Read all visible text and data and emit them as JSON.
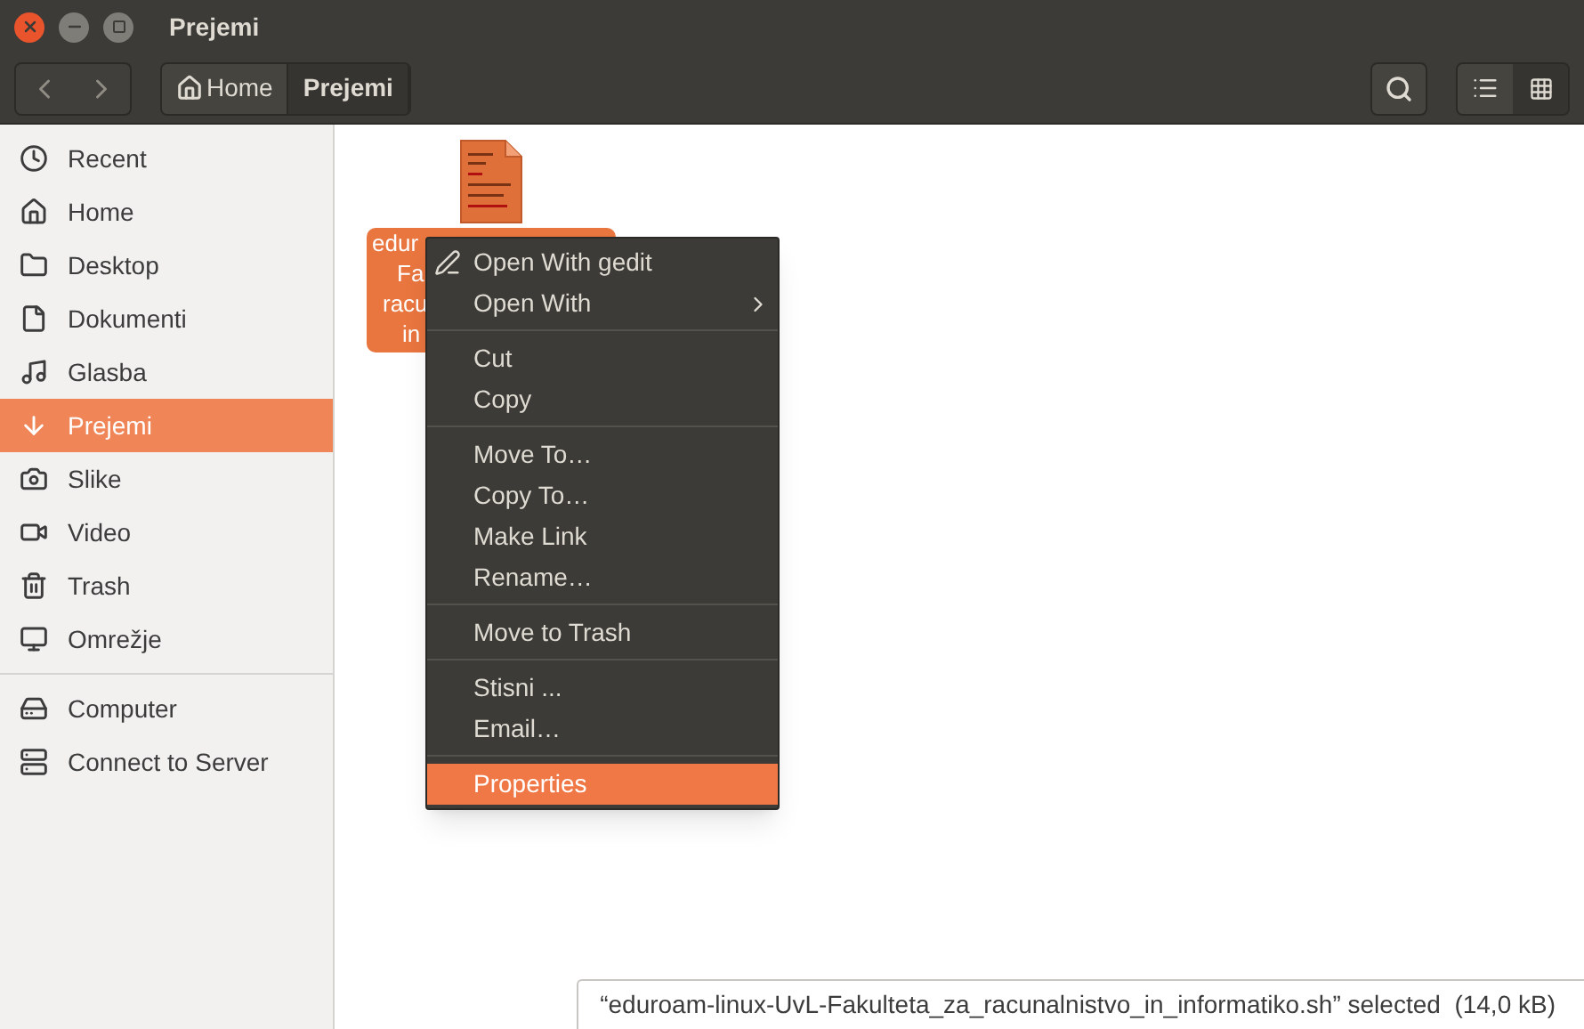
{
  "window": {
    "title": "Prejemi"
  },
  "path_bar": [
    {
      "label": "Home",
      "kind": "home",
      "selected": false
    },
    {
      "label": "Prejemi",
      "kind": "folder",
      "selected": true
    }
  ],
  "view_toggle": [
    {
      "kind": "list",
      "selected": false
    },
    {
      "kind": "grid",
      "selected": true
    }
  ],
  "sidebar": {
    "groups": [
      {
        "items": [
          {
            "label": "Recent",
            "selected": false
          },
          {
            "label": "Home",
            "selected": false
          },
          {
            "label": "Desktop",
            "selected": false
          },
          {
            "label": "Dokumenti",
            "selected": false
          },
          {
            "label": "Glasba",
            "selected": false
          },
          {
            "label": "Prejemi",
            "selected": true
          },
          {
            "label": "Slike",
            "selected": false
          },
          {
            "label": "Video",
            "selected": false
          },
          {
            "label": "Trash",
            "selected": false
          },
          {
            "label": "Omrežje",
            "selected": false
          }
        ]
      },
      {
        "items": [
          {
            "label": "Computer",
            "selected": false
          },
          {
            "label": "Connect to Server",
            "selected": false
          }
        ]
      }
    ]
  },
  "files": [
    {
      "label_lines": [
        "edur",
        "Fa",
        "racu",
        "in"
      ],
      "selected": true
    }
  ],
  "context_menu": {
    "groups": [
      [
        {
          "label": "Open With gedit",
          "kind": "app",
          "selected": false
        },
        {
          "label": "Open With",
          "kind": "submenu",
          "selected": false
        }
      ],
      [
        {
          "label": "Cut",
          "kind": "plain",
          "selected": false
        },
        {
          "label": "Copy",
          "kind": "plain",
          "selected": false
        }
      ],
      [
        {
          "label": "Move To…",
          "kind": "plain",
          "selected": false
        },
        {
          "label": "Copy To…",
          "kind": "plain",
          "selected": false
        },
        {
          "label": "Make Link",
          "kind": "plain",
          "selected": false
        },
        {
          "label": "Rename…",
          "kind": "plain",
          "selected": false
        }
      ],
      [
        {
          "label": "Move to Trash",
          "kind": "plain",
          "selected": false
        }
      ],
      [
        {
          "label": "Stisni ...",
          "kind": "plain",
          "selected": false
        },
        {
          "label": "Email…",
          "kind": "plain",
          "selected": false
        }
      ],
      [
        {
          "label": "Properties",
          "kind": "plain",
          "selected": true
        }
      ]
    ]
  },
  "status_bar": "“eduroam-linux-UvL-Fakulteta_za_racunalnistvo_in_informatiko.sh” selected  (14,0 kB)"
}
